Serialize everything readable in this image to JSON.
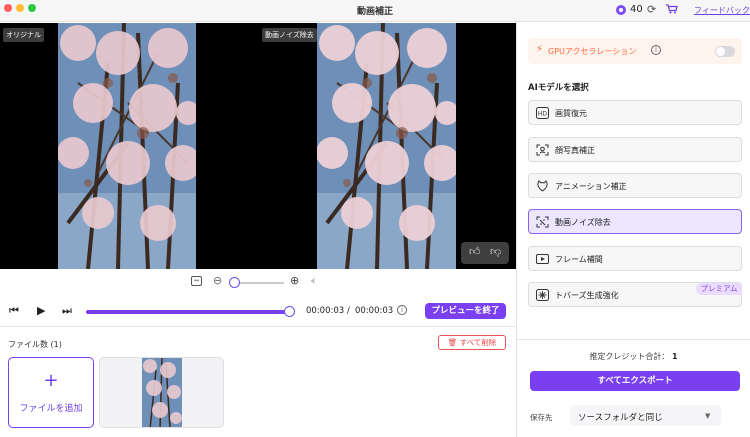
{
  "window": {
    "title": "動画補正"
  },
  "header": {
    "credits": "40",
    "feedback_label": "フィードバック"
  },
  "preview": {
    "original_tag": "オリジナル",
    "processed_tag": "動画ノイズ除去"
  },
  "playback": {
    "current_time": "00:00:03",
    "separator": "/",
    "total_time": "00:00:03",
    "end_preview_label": "プレビューを終了",
    "progress": 1.0
  },
  "files": {
    "count_label": "ファイル数 (1)",
    "delete_all_label": "すべて削除",
    "add_file_label": "ファイルを追加"
  },
  "sidebar": {
    "gpu_label": "GPUアクセラレーション",
    "gpu_enabled": false,
    "section_title": "AIモデルを選択",
    "models": [
      {
        "label": "画質復元",
        "icon": "hd-icon"
      },
      {
        "label": "顔写真補正",
        "icon": "face-scan-icon"
      },
      {
        "label": "アニメーション補正",
        "icon": "anime-icon"
      },
      {
        "label": "動画ノイズ除去",
        "icon": "denoise-icon",
        "selected": true
      },
      {
        "label": "フレーム補間",
        "icon": "frame-icon"
      },
      {
        "label": "トバーズ生成強化",
        "icon": "sparkle-icon",
        "badge": "プレミアム"
      }
    ],
    "credit_label": "推定クレジット合計：",
    "credit_value": "1",
    "export_label": "すべてエクスポート",
    "save_label": "保存先",
    "save_value": "ソースフォルダと同じ"
  },
  "colors": {
    "accent": "#7b3ff2",
    "delete": "#e44444",
    "gpu": "#ff6a3d",
    "premium": "#8c4bd8"
  }
}
